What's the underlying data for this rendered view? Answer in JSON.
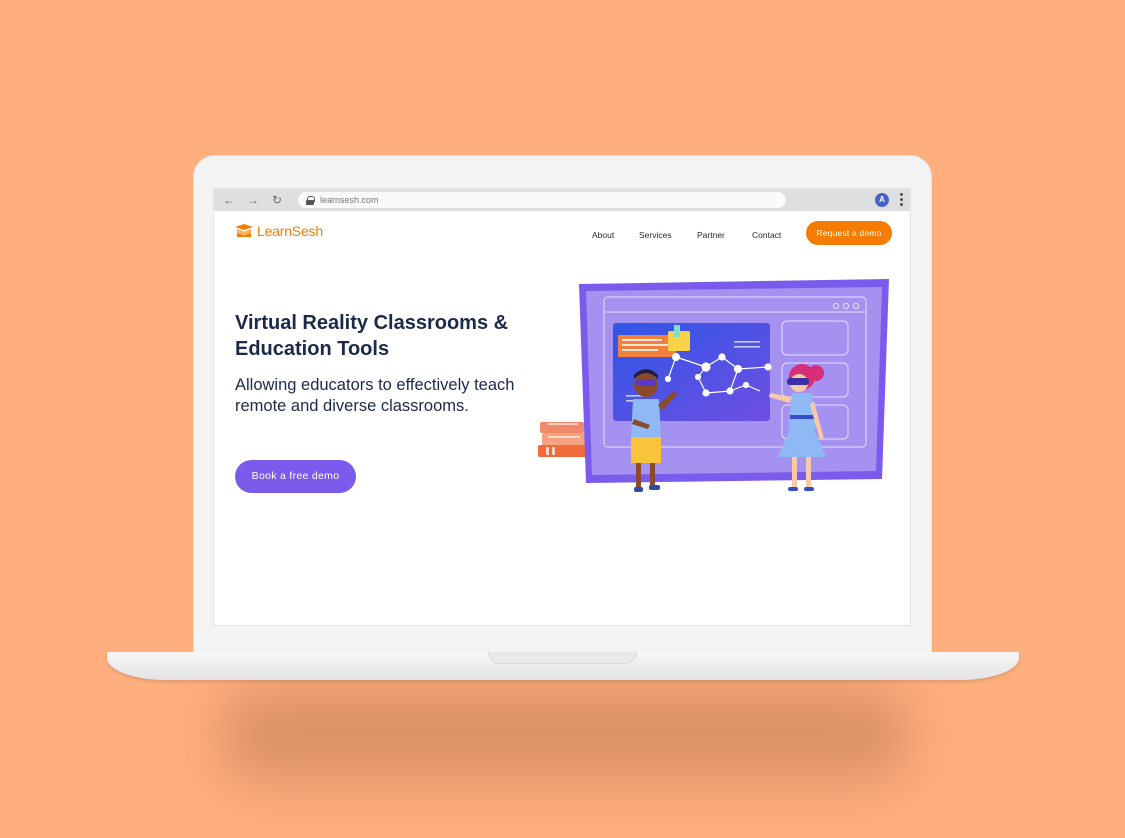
{
  "browser": {
    "url": "learnsesh.com",
    "profile_initial": "A",
    "back_glyph": "←",
    "forward_glyph": "→",
    "reload_glyph": "↻"
  },
  "site": {
    "brand": "LearnSesh",
    "nav": {
      "about": "About",
      "services": "Services",
      "partner": "Partner",
      "contact": "Contact",
      "cta": "Request a demo"
    },
    "hero": {
      "title": "Virtual Reality Classrooms & Education Tools",
      "subtitle": "Allowing educators to effectively teach remote and diverse classrooms.",
      "button": "Book a free demo"
    }
  },
  "colors": {
    "background": "#FFAE7D",
    "brand_orange": "#F57C00",
    "primary_purple": "#7B5BEB",
    "heading_navy": "#1b2a4a"
  },
  "icons": [
    "back-arrow-icon",
    "forward-arrow-icon",
    "reload-icon",
    "lock-icon",
    "kebab-menu-icon",
    "logo-icon"
  ]
}
